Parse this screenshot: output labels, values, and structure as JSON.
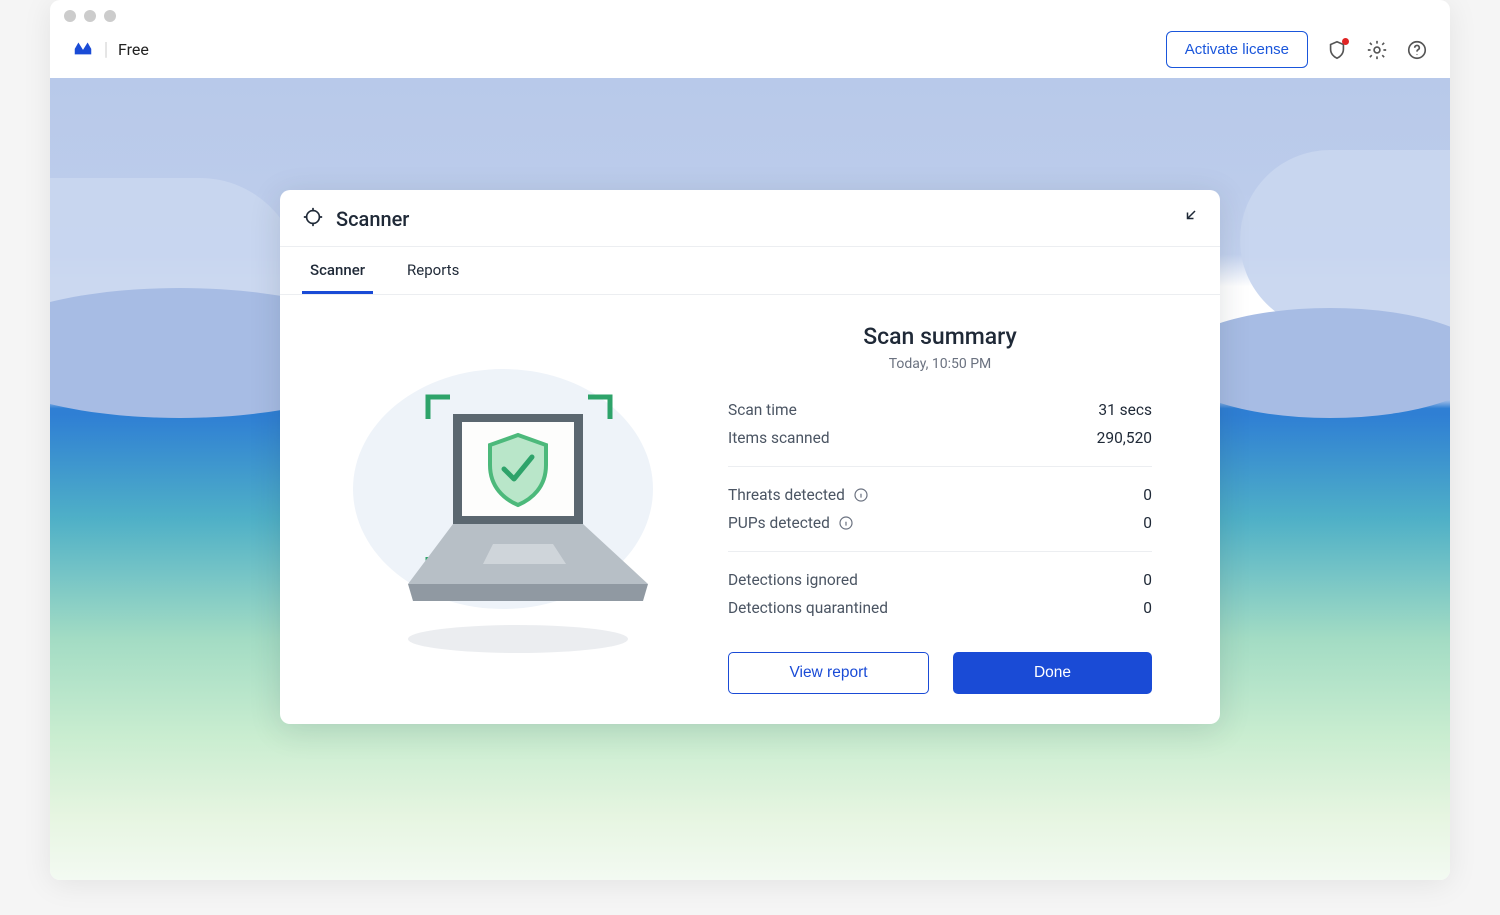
{
  "header": {
    "tier": "Free",
    "activate_label": "Activate license"
  },
  "panel": {
    "title": "Scanner",
    "tabs": [
      {
        "label": "Scanner",
        "active": true
      },
      {
        "label": "Reports",
        "active": false
      }
    ]
  },
  "summary": {
    "title": "Scan summary",
    "timestamp": "Today, 10:50 PM",
    "rows": {
      "scan_time_label": "Scan time",
      "scan_time_value": "31 secs",
      "items_scanned_label": "Items scanned",
      "items_scanned_value": "290,520",
      "threats_label": "Threats detected",
      "threats_value": "0",
      "pups_label": "PUPs detected",
      "pups_value": "0",
      "ignored_label": "Detections ignored",
      "ignored_value": "0",
      "quarantined_label": "Detections quarantined",
      "quarantined_value": "0"
    },
    "view_report_label": "View report",
    "done_label": "Done"
  }
}
